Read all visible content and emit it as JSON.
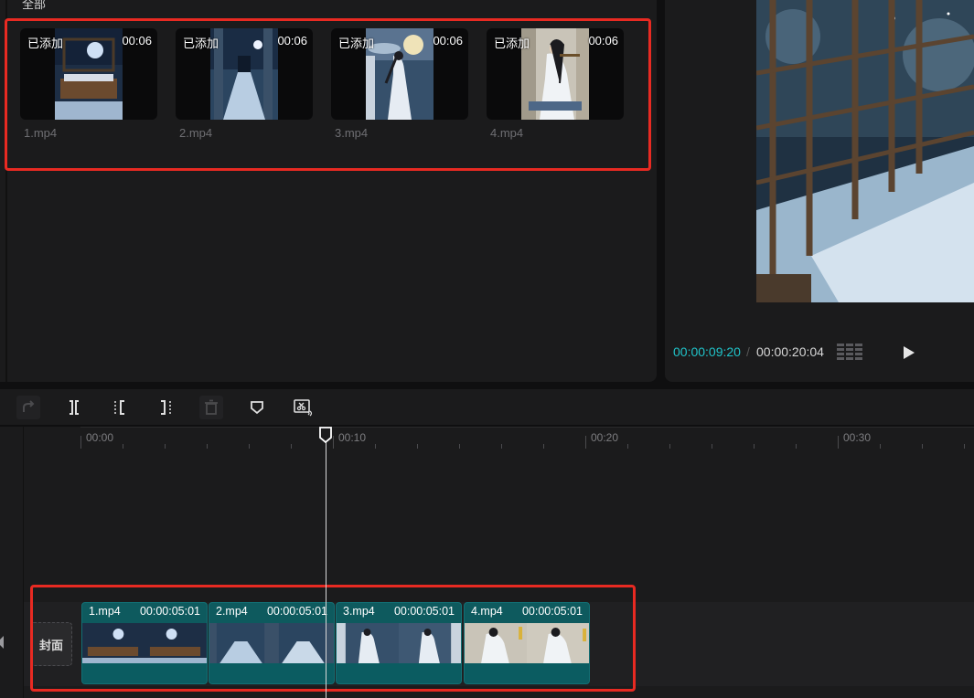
{
  "media": {
    "category": "全部",
    "items": [
      {
        "name": "1.mp4",
        "badge": "已添加",
        "duration": "00:06"
      },
      {
        "name": "2.mp4",
        "badge": "已添加",
        "duration": "00:06"
      },
      {
        "name": "3.mp4",
        "badge": "已添加",
        "duration": "00:06"
      },
      {
        "name": "4.mp4",
        "badge": "已添加",
        "duration": "00:06"
      }
    ]
  },
  "preview": {
    "current_time": "00:00:09:20",
    "separator": "/",
    "total_time": "00:00:20:04"
  },
  "toolbar": {
    "icons": [
      "redo-icon",
      "split-icon",
      "trim-left-icon",
      "trim-right-icon",
      "delete-icon",
      "marker-icon",
      "auto-cut-icon"
    ]
  },
  "timeline": {
    "ruler": [
      "00:00",
      "00:10",
      "00:20",
      "00:30"
    ],
    "cover_label": "封面",
    "clips": [
      {
        "name": "1.mp4",
        "duration": "00:00:05:01"
      },
      {
        "name": "2.mp4",
        "duration": "00:00:05:01"
      },
      {
        "name": "3.mp4",
        "duration": "00:00:05:01"
      },
      {
        "name": "4.mp4",
        "duration": "00:00:05:01"
      }
    ]
  },
  "colors": {
    "accent_time": "#20c3c9",
    "highlight_box": "#e82a22",
    "clip_fill": "#0e5a5e"
  }
}
